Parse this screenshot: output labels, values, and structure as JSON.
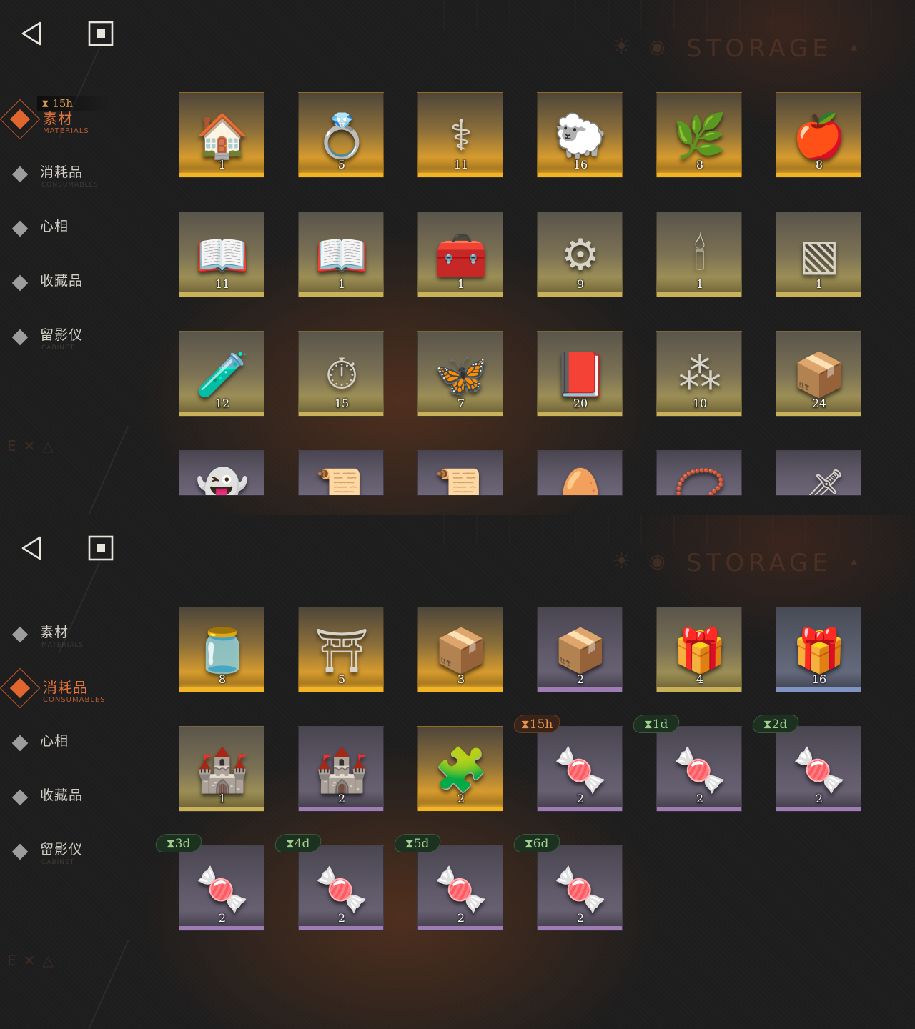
{
  "storage_watermark": "STORAGE",
  "panels": [
    {
      "nav": [
        {
          "label": "素材",
          "sub": "MATERIALS",
          "active": true
        },
        {
          "label": "消耗品",
          "sub": "CONSUMABLES",
          "active": false
        },
        {
          "label": "心相",
          "sub": "",
          "active": false
        },
        {
          "label": "收藏品",
          "sub": "",
          "active": false
        },
        {
          "label": "留影仪",
          "sub": "CABINET",
          "active": false
        }
      ],
      "nav_timer": "15h",
      "items": [
        {
          "icon": "hut-on-legs-icon",
          "glyph": "🏠",
          "count": "1",
          "rarity": "gold"
        },
        {
          "icon": "golden-ring-icon",
          "glyph": "💍",
          "count": "5",
          "rarity": "gold"
        },
        {
          "icon": "caduceus-icon",
          "glyph": "⚕",
          "count": "11",
          "rarity": "gold"
        },
        {
          "icon": "golden-sheep-icon",
          "glyph": "🐑",
          "count": "16",
          "rarity": "gold"
        },
        {
          "icon": "laurel-branch-icon",
          "glyph": "🌿",
          "count": "8",
          "rarity": "gold"
        },
        {
          "icon": "apple-serpent-icon",
          "glyph": "🍎",
          "count": "8",
          "rarity": "gold"
        },
        {
          "icon": "open-book-red-icon",
          "glyph": "📖",
          "count": "11",
          "rarity": "yellow"
        },
        {
          "icon": "open-book-gold-icon",
          "glyph": "📖",
          "count": "1",
          "rarity": "yellow"
        },
        {
          "icon": "overgrown-chest-icon",
          "glyph": "🧰",
          "count": "1",
          "rarity": "yellow"
        },
        {
          "icon": "astrolabe-icon",
          "glyph": "⚙",
          "count": "9",
          "rarity": "yellow"
        },
        {
          "icon": "ouija-board-icon",
          "glyph": "🕯",
          "count": "1",
          "rarity": "yellow"
        },
        {
          "icon": "green-tablet-icon",
          "glyph": "▧",
          "count": "1",
          "rarity": "yellow"
        },
        {
          "icon": "potion-bottle-icon",
          "glyph": "🧪",
          "count": "12",
          "rarity": "yellow"
        },
        {
          "icon": "pocket-watch-icon",
          "glyph": "⏱",
          "count": "15",
          "rarity": "yellow"
        },
        {
          "icon": "moth-lamp-icon",
          "glyph": "🦋",
          "count": "7",
          "rarity": "yellow"
        },
        {
          "icon": "dark-tome-icon",
          "glyph": "📕",
          "count": "20",
          "rarity": "yellow"
        },
        {
          "icon": "bullets-icon",
          "glyph": "⁂",
          "count": "10",
          "rarity": "yellow"
        },
        {
          "icon": "hand-box-icon",
          "glyph": "📦",
          "count": "24",
          "rarity": "yellow"
        },
        {
          "icon": "ghost-icon",
          "glyph": "👻",
          "count": "",
          "rarity": "purple"
        },
        {
          "icon": "scroll-red-icon",
          "glyph": "📜",
          "count": "",
          "rarity": "purple"
        },
        {
          "icon": "scroll-green-icon",
          "glyph": "📜",
          "count": "",
          "rarity": "purple"
        },
        {
          "icon": "ornate-egg-icon",
          "glyph": "🥚",
          "count": "",
          "rarity": "purple"
        },
        {
          "icon": "amulet-icon",
          "glyph": "📿",
          "count": "",
          "rarity": "purple"
        },
        {
          "icon": "dagger-icon",
          "glyph": "🗡",
          "count": "",
          "rarity": "purple"
        }
      ]
    },
    {
      "nav": [
        {
          "label": "素材",
          "sub": "MATERIALS",
          "active": false
        },
        {
          "label": "消耗品",
          "sub": "CONSUMABLES",
          "active": true
        },
        {
          "label": "心相",
          "sub": "",
          "active": false
        },
        {
          "label": "收藏品",
          "sub": "",
          "active": false
        },
        {
          "label": "留影仪",
          "sub": "CABINET",
          "active": false
        }
      ],
      "items": [
        {
          "icon": "candy-jar-icon",
          "glyph": "🫙",
          "count": "8",
          "rarity": "gold"
        },
        {
          "icon": "rune-table-icon",
          "glyph": "⛩",
          "count": "5",
          "rarity": "gold"
        },
        {
          "icon": "wooden-crate-icon",
          "glyph": "📦",
          "count": "3",
          "rarity": "gold"
        },
        {
          "icon": "wooden-crate-icon",
          "glyph": "📦",
          "count": "2",
          "rarity": "purple"
        },
        {
          "icon": "wrapped-parcel-icon",
          "glyph": "🎁",
          "count": "4",
          "rarity": "yellow"
        },
        {
          "icon": "wrapped-parcel-icon",
          "glyph": "🎁",
          "count": "16",
          "rarity": "blue"
        },
        {
          "icon": "sand-castle-icon",
          "glyph": "🏰",
          "count": "1",
          "rarity": "yellow"
        },
        {
          "icon": "sand-castle-icon",
          "glyph": "🏰",
          "count": "2",
          "rarity": "purple"
        },
        {
          "icon": "octagon-puzzle-icon",
          "glyph": "🧩",
          "count": "2",
          "rarity": "gold"
        },
        {
          "icon": "candies-icon",
          "glyph": "🍬",
          "count": "2",
          "rarity": "purple",
          "badge": "15h",
          "badge_color": "orange"
        },
        {
          "icon": "candies-icon",
          "glyph": "🍬",
          "count": "2",
          "rarity": "purple",
          "badge": "1d",
          "badge_color": "green"
        },
        {
          "icon": "candies-icon",
          "glyph": "🍬",
          "count": "2",
          "rarity": "purple",
          "badge": "2d",
          "badge_color": "green"
        },
        {
          "icon": "candies-icon",
          "glyph": "🍬",
          "count": "2",
          "rarity": "purple",
          "badge": "3d",
          "badge_color": "green"
        },
        {
          "icon": "candies-icon",
          "glyph": "🍬",
          "count": "2",
          "rarity": "purple",
          "badge": "4d",
          "badge_color": "green"
        },
        {
          "icon": "candies-icon",
          "glyph": "🍬",
          "count": "2",
          "rarity": "purple",
          "badge": "5d",
          "badge_color": "green"
        },
        {
          "icon": "candies-icon",
          "glyph": "🍬",
          "count": "2",
          "rarity": "purple",
          "badge": "6d",
          "badge_color": "green"
        }
      ]
    }
  ],
  "colors": {
    "accent": "#e0662e",
    "gold": "#e7a629",
    "timer_orange": "#e4934c",
    "timer_green": "#9fd08e"
  }
}
